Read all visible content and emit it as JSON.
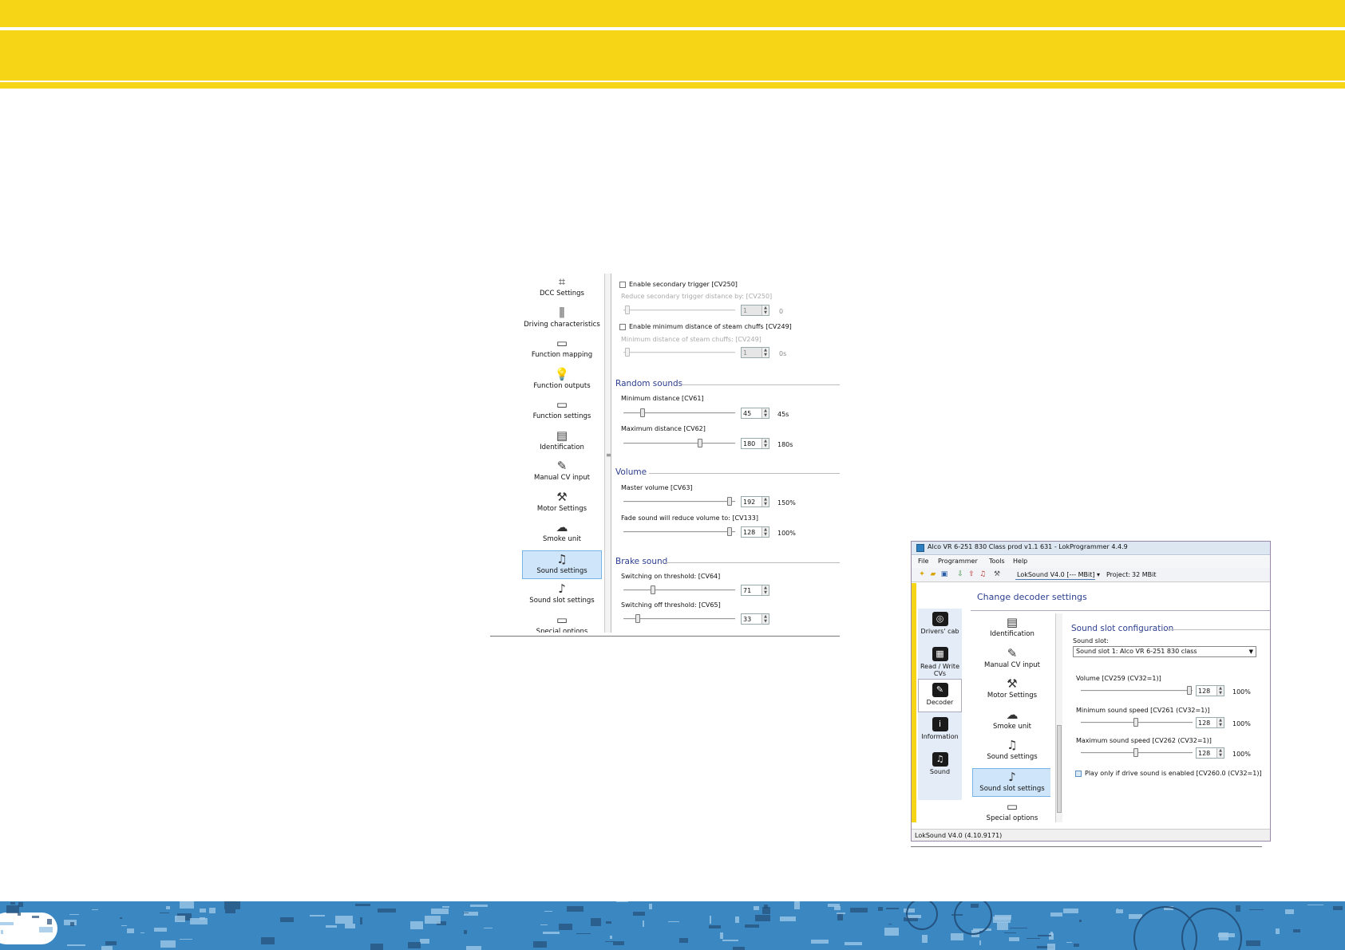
{
  "screenshot1": {
    "nav": [
      {
        "label": "DCC Settings",
        "icon": "dcc-settings-icon",
        "glyph": "⌗"
      },
      {
        "label": "Driving characteristics",
        "icon": "driving-characteristics-icon",
        "glyph": "⫼"
      },
      {
        "label": "Function mapping",
        "icon": "function-mapping-icon",
        "glyph": "▭"
      },
      {
        "label": "Function outputs",
        "icon": "lightbulb-icon",
        "glyph": "💡"
      },
      {
        "label": "Function settings",
        "icon": "function-settings-icon",
        "glyph": "▭"
      },
      {
        "label": "Identification",
        "icon": "id-card-icon",
        "glyph": "▤"
      },
      {
        "label": "Manual CV input",
        "icon": "manual-cv-input-icon",
        "glyph": "✎"
      },
      {
        "label": "Motor Settings",
        "icon": "wrench-icon",
        "glyph": "⚒"
      },
      {
        "label": "Smoke unit",
        "icon": "smoke-icon",
        "glyph": "☁"
      },
      {
        "label": "Sound settings",
        "icon": "sound-notes-icon",
        "glyph": "♫"
      },
      {
        "label": "Sound slot settings",
        "icon": "sound-slot-icon",
        "glyph": "♪"
      },
      {
        "label": "Special options",
        "icon": "special-options-icon",
        "glyph": "▭"
      }
    ],
    "selected_nav": "Sound settings",
    "secondary_trigger": {
      "checkbox_label": "Enable secondary trigger [CV250]",
      "slider_label": "Reduce secondary trigger distance by: [CV250]",
      "value": "1",
      "unit": "0"
    },
    "steam_chuffs": {
      "checkbox_label": "Enable minimum distance of steam chuffs [CV249]",
      "slider_label": "Minimum distance of steam chuffs: [CV249]",
      "value": "1",
      "unit": "0s"
    },
    "random_sounds": {
      "title": "Random sounds",
      "min_label": "Minimum distance [CV61]",
      "min_value": "45",
      "min_unit": "45s",
      "max_label": "Maximum distance [CV62]",
      "max_value": "180",
      "max_unit": "180s"
    },
    "volume": {
      "title": "Volume",
      "master_label": "Master volume [CV63]",
      "master_value": "192",
      "master_unit": "150%",
      "fade_label": "Fade sound will reduce volume to: [CV133]",
      "fade_value": "128",
      "fade_unit": "100%"
    },
    "brake_sound": {
      "title": "Brake sound",
      "on_label": "Switching on threshold: [CV64]",
      "on_value": "71",
      "off_label": "Switching off threshold: [CV65]",
      "off_value": "33"
    }
  },
  "screenshot2": {
    "window_title": "Alco VR 6-251 830 Class prod v1.1 631 - LokProgrammer 4.4.9",
    "menu": [
      "File",
      "Programmer",
      "Tools",
      "Help"
    ],
    "decoder_dropdown": "LokSound V4.0 [--- MBit]",
    "project_label": "Project:",
    "project_value": "32 MBit",
    "heading": "Change decoder settings",
    "sidebar": [
      {
        "label": "Drivers' cab",
        "icon": "drivers-cab-icon",
        "glyph": "◎"
      },
      {
        "label": "Read / Write CVs",
        "icon": "read-write-cvs-icon",
        "glyph": "▦"
      },
      {
        "label": "Decoder",
        "icon": "decoder-icon",
        "glyph": "✎"
      },
      {
        "label": "Information",
        "icon": "information-icon",
        "glyph": "i"
      },
      {
        "label": "Sound",
        "icon": "sound-icon",
        "glyph": "♫"
      }
    ],
    "selected_sidebar": "Decoder",
    "nav": [
      {
        "label": "Identification",
        "icon": "id-card-icon",
        "glyph": "▤"
      },
      {
        "label": "Manual CV input",
        "icon": "manual-cv-input-icon",
        "glyph": "✎"
      },
      {
        "label": "Motor Settings",
        "icon": "wrench-icon",
        "glyph": "⚒"
      },
      {
        "label": "Smoke unit",
        "icon": "smoke-icon",
        "glyph": "☁"
      },
      {
        "label": "Sound settings",
        "icon": "sound-notes-icon",
        "glyph": "♫"
      },
      {
        "label": "Sound slot settings",
        "icon": "sound-slot-icon",
        "glyph": "♪"
      },
      {
        "label": "Special options",
        "icon": "special-options-icon",
        "glyph": "▭"
      }
    ],
    "selected_nav": "Sound slot settings",
    "panel": {
      "title": "Sound slot configuration",
      "slot_label": "Sound slot:",
      "slot_value": "Sound slot 1: Alco VR 6-251 830 class",
      "volume_label": "Volume [CV259 (CV32=1)]",
      "volume_value": "128",
      "volume_unit": "100%",
      "min_speed_label": "Minimum sound speed [CV261 (CV32=1)]",
      "min_speed_value": "128",
      "min_speed_unit": "100%",
      "max_speed_label": "Maximum sound speed [CV262 (CV32=1)]",
      "max_speed_value": "128",
      "max_speed_unit": "100%",
      "play_only_label": "Play only if drive sound is enabled [CV260.0 (CV32=1)]"
    },
    "status": "LokSound V4.0 (4.10.9171)"
  },
  "colors": {
    "header_yellow": "#f5d516",
    "footer_blue": "#3b87c1",
    "section_blue": "#2c3e8f",
    "selection_bg": "#cfe5f9"
  }
}
